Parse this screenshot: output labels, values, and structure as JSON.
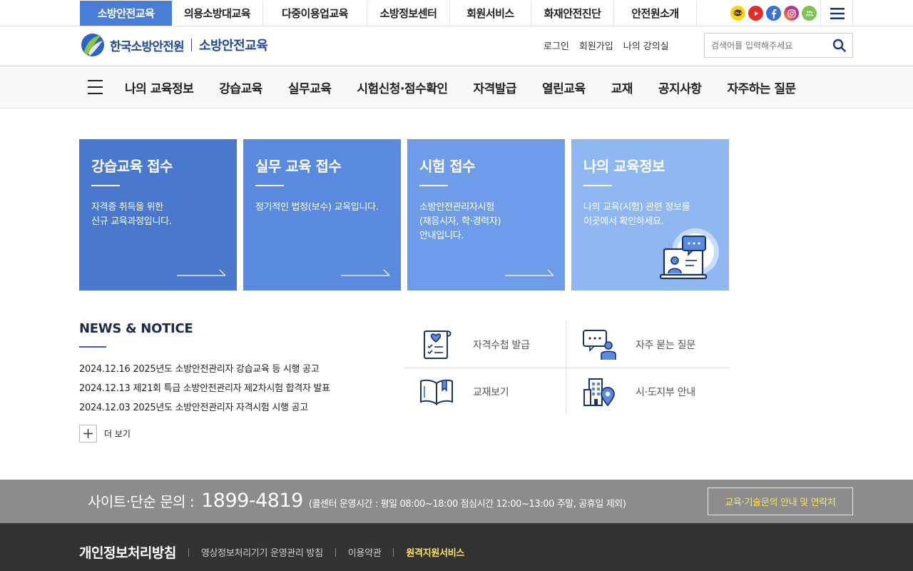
{
  "top_tabs": [
    {
      "label": "소방안전교육",
      "active": true
    },
    {
      "label": "의용소방대교육"
    },
    {
      "label": "다중이용업교육"
    },
    {
      "label": "소방정보센터"
    },
    {
      "label": "회원서비스"
    },
    {
      "label": "화재안전진단"
    },
    {
      "label": "안전원소개"
    }
  ],
  "social_icons": [
    "kakao-icon",
    "youtube-icon",
    "facebook-icon",
    "instagram-icon",
    "info-icon"
  ],
  "logo": {
    "org": "한국소방안전원",
    "site": "소방안전교육"
  },
  "util_links": [
    "로그인",
    "회원가입",
    "나의 강의실"
  ],
  "search": {
    "placeholder": "검색어를 입력해주세요"
  },
  "gnb": [
    "나의 교육정보",
    "강습교육",
    "실무교육",
    "시험신청·점수확인",
    "자격발급",
    "열린교육",
    "교재",
    "공지사항",
    "자주하는 질문"
  ],
  "cards": [
    {
      "title": "강습교육 접수",
      "desc": "자격증 취득을 위한\n신규 교육과정입니다.",
      "color": "#4a78cd"
    },
    {
      "title": "실무 교육 접수",
      "desc": "정기적인 법정(보수) 교육입니다.",
      "color": "#5a8ae0"
    },
    {
      "title": "시험 접수",
      "desc": "소방안전관리자시험\n(재응시자, 학·경력자)\n안내입니다.",
      "color": "#6f9ce8"
    },
    {
      "title": "나의 교육정보",
      "desc": "나의 교육(시험) 관련 정보를\n이곳에서 확인하세요.",
      "color": "#8fb8f3"
    }
  ],
  "news": {
    "title": "NEWS & NOTICE",
    "items": [
      {
        "date": "2024.12.16",
        "text": "2025년도 소방안전관리자 강습교육 등 시행 공고"
      },
      {
        "date": "2024.12.13",
        "text": "제21회 특급 소방안전관리자 제2차시험 합격자 발표"
      },
      {
        "date": "2024.12.03",
        "text": "2025년도 소방안전관리자 자격시험 시행 공고"
      }
    ],
    "more_label": "더 보기"
  },
  "quick_links": [
    {
      "label": "자격수첩 발급",
      "icon": "certificate-icon"
    },
    {
      "label": "자주 묻는 질문",
      "icon": "faq-icon"
    },
    {
      "label": "교재보기",
      "icon": "book-icon"
    },
    {
      "label": "시·도지부 안내",
      "icon": "building-location-icon"
    }
  ],
  "contact": {
    "label": "사이트·단순 문의 :",
    "phone": "1899-4819",
    "hours": "(콜센터 운영시간 : 평일 08:00~18:00  점심시간 12:00~13:00  주말, 공휴일 제외)",
    "button": "교육·기술문의 안내 및 연락처"
  },
  "footer": {
    "main": "개인정보처리방침",
    "links": [
      "영상정보처리기기 운영관리 방침",
      "이용약관",
      "원격지원서비스"
    ]
  }
}
